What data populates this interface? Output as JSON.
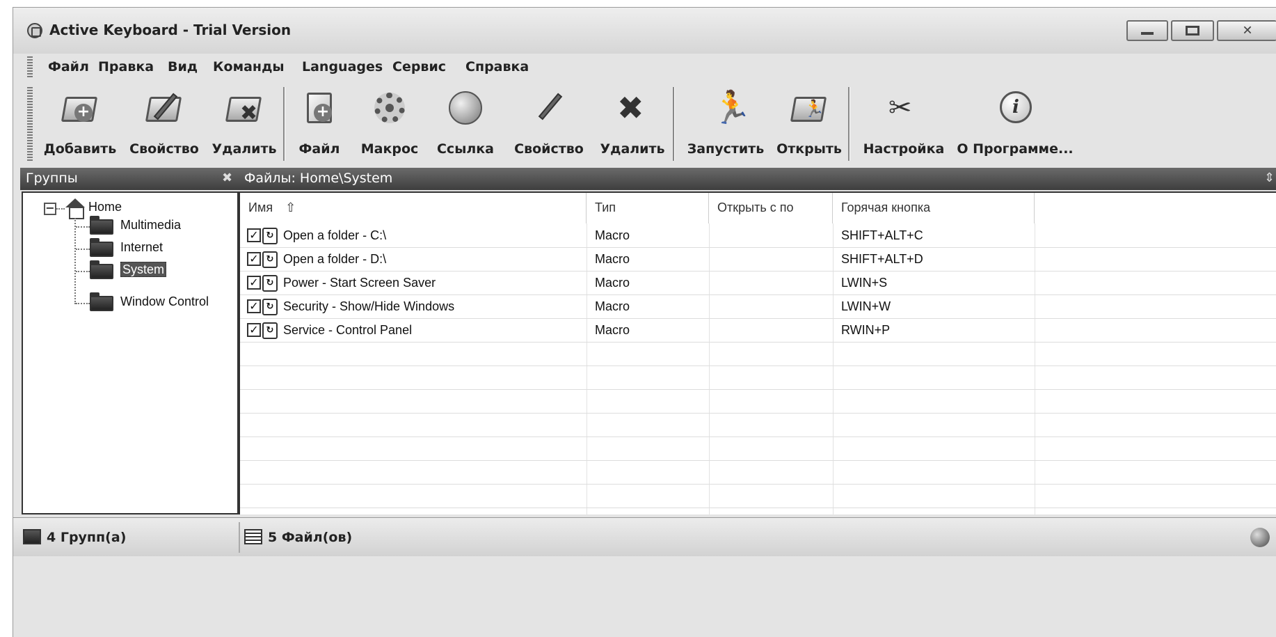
{
  "window": {
    "title": "Active Keyboard - Trial Version",
    "close_glyph": "✕"
  },
  "menu": [
    "Файл",
    "Правка",
    "Вид",
    "Команды",
    "Languages",
    "Сервис",
    "Справка"
  ],
  "toolbar": {
    "groups": [
      "Добавить",
      "Свойство",
      "Удалить"
    ],
    "items": [
      "Файл",
      "Макрос",
      "Ссылка",
      "Свойство",
      "Удалить"
    ],
    "actions": [
      "Запустить",
      "Открыть"
    ],
    "settings": [
      "Настройка",
      "О Программе..."
    ]
  },
  "groups_panel": {
    "title": "Группы",
    "close": "✖",
    "tree": {
      "root": "Home",
      "expander": "−",
      "children": [
        "Multimedia",
        "Internet",
        "System",
        "Window Control"
      ],
      "selected": "System"
    }
  },
  "files_panel": {
    "title": "Файлы: Home\\System",
    "pin": "⇕",
    "columns": [
      "Имя",
      "Тип",
      "Открыть с по",
      "Горячая кнопка"
    ],
    "sort_arrow": "⇧",
    "rows": [
      {
        "checked": "✓",
        "name": "Open a folder - C:\\",
        "type": "Macro",
        "open_with": "",
        "hotkey": "SHIFT+ALT+C"
      },
      {
        "checked": "✓",
        "name": "Open a folder - D:\\",
        "type": "Macro",
        "open_with": "",
        "hotkey": "SHIFT+ALT+D"
      },
      {
        "checked": "✓",
        "name": "Power - Start Screen Saver",
        "type": "Macro",
        "open_with": "",
        "hotkey": "LWIN+S"
      },
      {
        "checked": "✓",
        "name": "Security - Show/Hide Windows",
        "type": "Macro",
        "open_with": "",
        "hotkey": "LWIN+W"
      },
      {
        "checked": "✓",
        "name": "Service - Control Panel",
        "type": "Macro",
        "open_with": "",
        "hotkey": "RWIN+P"
      }
    ]
  },
  "statusbar": {
    "groups_count": "4 Групп(а)",
    "files_count": "5 Файл(ов)"
  }
}
